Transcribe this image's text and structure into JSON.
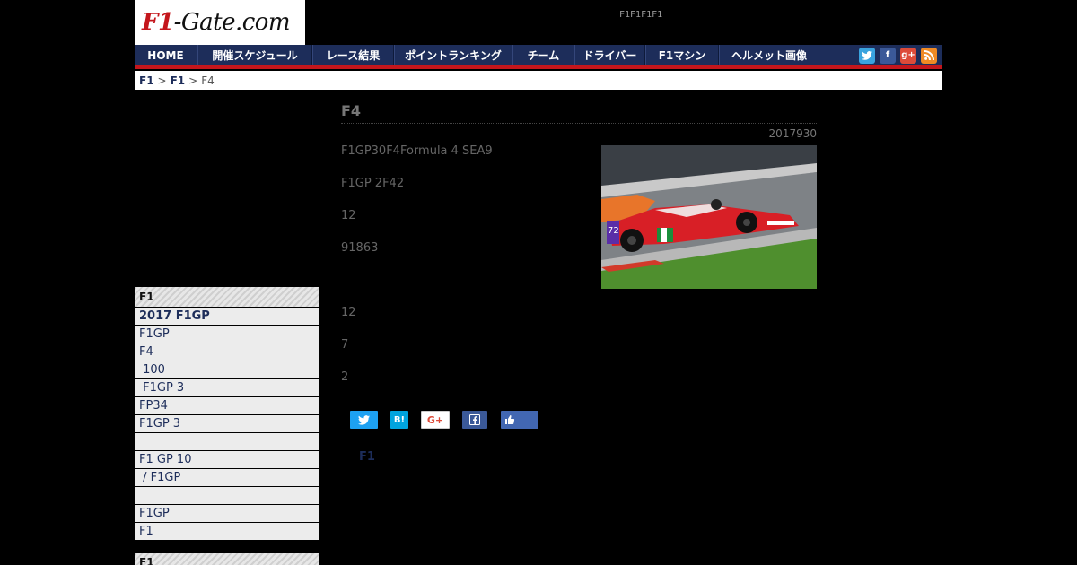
{
  "logo": {
    "prefix": "F1",
    "suffix": "-Gate.com"
  },
  "tagline": "F1F1F1F1",
  "nav": {
    "items": [
      "HOME",
      "開催スケジュール",
      "レース結果",
      "ポイントランキング",
      "チーム",
      "ドライバー",
      "F1マシン",
      "ヘルメット画像"
    ],
    "social": [
      "twitter-icon",
      "facebook-icon",
      "google-plus-icon",
      "rss-icon"
    ],
    "colors": {
      "bar": "#1d2d5a",
      "accent": "#c4161c"
    }
  },
  "breadcrumb": {
    "home": "F1",
    "section": "F1",
    "sep": ">",
    "current": "F4"
  },
  "article": {
    "title": "F4",
    "date": "2017930",
    "paragraphs": [
      "F1GP30F4Formula 4 SEA9",
      "F1GP 2F42",
      "12",
      "91863",
      "12",
      "7",
      "2"
    ]
  },
  "share": {
    "twitter": "",
    "hatena": "B!",
    "google": "G+",
    "facebook": "",
    "like": ""
  },
  "related_label": "F1",
  "sidebar": {
    "heading": "F1",
    "items": [
      "2017 F1GP",
      "F1GP",
      "F4",
      " 100",
      " F1GP 3",
      "FP34",
      "F1GP 3",
      "",
      "F1 GP 10",
      " / F1GP",
      "",
      "F1GP",
      "F1"
    ],
    "heading2": "F1"
  }
}
